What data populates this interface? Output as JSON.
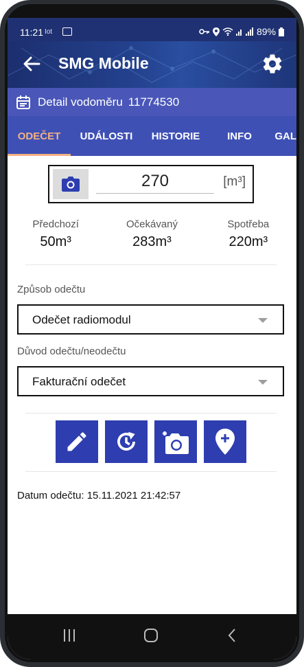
{
  "status_bar": {
    "time": "11:21",
    "iot": "Iot",
    "battery": "89%"
  },
  "app": {
    "title": "SMG Mobile"
  },
  "subheader": {
    "label": "Detail vodoměru",
    "meter_number": "11774530"
  },
  "tabs": [
    {
      "label": "ODEČET",
      "active": true
    },
    {
      "label": "UDÁLOSTI",
      "active": false
    },
    {
      "label": "HISTORIE",
      "active": false
    },
    {
      "label": "INFO",
      "active": false
    },
    {
      "label": "GAL",
      "active": false
    }
  ],
  "reading": {
    "value": "270",
    "unit": "[m³]"
  },
  "stats": [
    {
      "label": "Předchozí",
      "value": "50m³"
    },
    {
      "label": "Očekávaný",
      "value": "283m³"
    },
    {
      "label": "Spotřeba",
      "value": "220m³"
    }
  ],
  "method": {
    "label": "Způsob odečtu",
    "value": "Odečet radiomodul"
  },
  "reason": {
    "label": "Důvod odečtu/neodečtu",
    "value": "Fakturační odečet"
  },
  "action_icons": [
    "edit-icon",
    "history-icon",
    "add-photo-icon",
    "add-location-icon"
  ],
  "datum": "Datum odečtu: 15.11.2021 21:42:57",
  "colors": {
    "primary": "#3f50b5",
    "accent": "#f4b183",
    "action": "#2e3eb0"
  }
}
